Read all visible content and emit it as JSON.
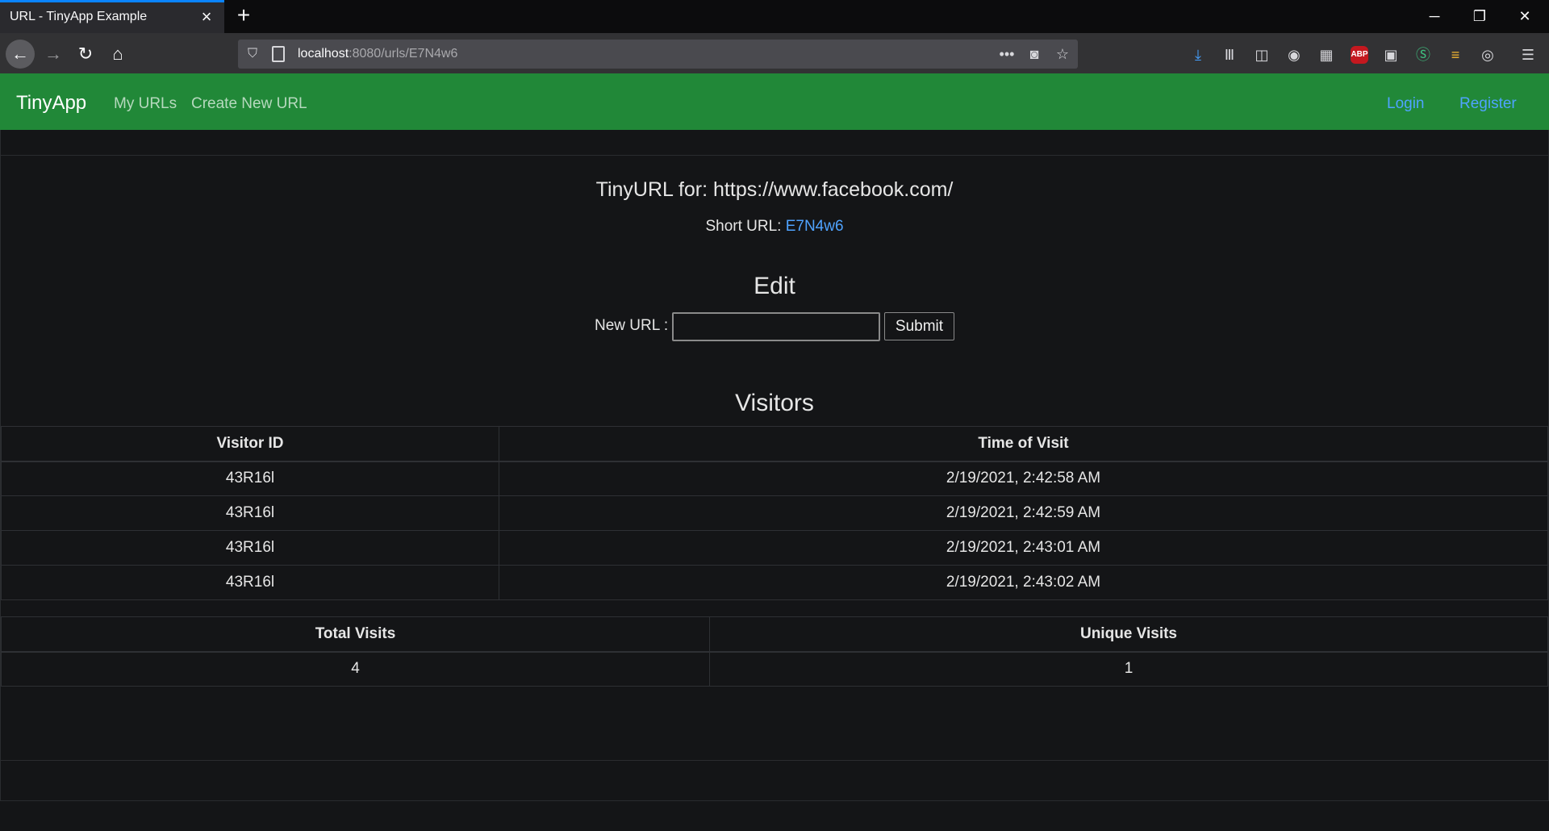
{
  "browser": {
    "tab_title": "URL - TinyApp Example",
    "url_host": "localhost",
    "url_path": ":8080/urls/E7N4w6"
  },
  "navbar": {
    "brand": "TinyApp",
    "links": [
      "My URLs",
      "Create New URL"
    ],
    "login": "Login",
    "register": "Register"
  },
  "main": {
    "title": "TinyURL for: https://www.facebook.com/",
    "short_url_label": "Short URL: ",
    "short_url_value": "E7N4w6",
    "edit_heading": "Edit",
    "new_url_label": "New URL :",
    "new_url_value": "",
    "submit_label": "Submit",
    "visitors_heading": "Visitors"
  },
  "visitors_table": {
    "headers": [
      "Visitor ID",
      "Time of Visit"
    ],
    "rows": [
      [
        "43R16l",
        "2/19/2021, 2:42:58 AM"
      ],
      [
        "43R16l",
        "2/19/2021, 2:42:59 AM"
      ],
      [
        "43R16l",
        "2/19/2021, 2:43:01 AM"
      ],
      [
        "43R16l",
        "2/19/2021, 2:43:02 AM"
      ]
    ]
  },
  "stats_table": {
    "headers": [
      "Total Visits",
      "Unique Visits"
    ],
    "values": [
      "4",
      "1"
    ]
  },
  "colors": {
    "navbar_green": "#218838",
    "link_blue": "#4fa3ff",
    "background": "#141517"
  }
}
